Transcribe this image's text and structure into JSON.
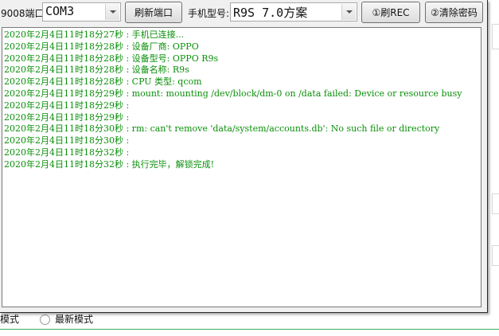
{
  "toolbar": {
    "port_label": "9008端口:",
    "port_value": "COM3",
    "refresh_port_label": "刷新端口",
    "model_label": "手机型号:",
    "model_value": "R9S 7.0方案",
    "flash_rec_label": "①刷REC",
    "clear_password_label": "②清除密码"
  },
  "log": {
    "lines": [
      "2020年2月4日11时18分27秒 : 手机已连接...",
      "2020年2月4日11时18分28秒 : 设备厂商: OPPO",
      "2020年2月4日11时18分28秒 : 设备型号: OPPO R9s",
      "2020年2月4日11时18分28秒 : 设备名称: R9s",
      "2020年2月4日11时18分28秒 : CPU 类型: qcom",
      "2020年2月4日11时18分29秒 : mount: mounting /dev/block/dm-0 on /data failed: Device or resource busy",
      "2020年2月4日11时18分29秒 :",
      "2020年2月4日11时18分29秒 :",
      "2020年2月4日11时18分30秒 : rm: can't remove 'data/system/accounts.db': No such file or directory",
      "2020年2月4日11时18分30秒 :",
      "2020年2月4日11时18分32秒 :",
      "2020年2月4日11时18分32秒 : 执行完毕，解锁完成!"
    ]
  },
  "background": {
    "mode_left_label": "模式",
    "mode_latest_label": "最新模式"
  },
  "colors": {
    "log_text": "#0a8f0a",
    "accent_line": "#3fae5f"
  }
}
